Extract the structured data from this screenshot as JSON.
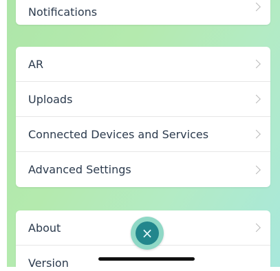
{
  "settings": {
    "top_items": [
      {
        "label": "Notifications"
      }
    ],
    "middle_items": [
      {
        "label": "AR"
      },
      {
        "label": "Uploads"
      },
      {
        "label": "Connected Devices and Services"
      },
      {
        "label": "Advanced Settings"
      }
    ],
    "bottom_items": [
      {
        "label": "About"
      },
      {
        "label": "Version"
      }
    ]
  },
  "fab": {
    "icon": "close-icon",
    "glyph": "×"
  },
  "colors": {
    "row_text": "#2b3a4d",
    "fab_outer": "#8fd8c6",
    "fab_inner": "#22868c",
    "background_start": "#aee6a9",
    "background_end": "#a8e8dc"
  }
}
